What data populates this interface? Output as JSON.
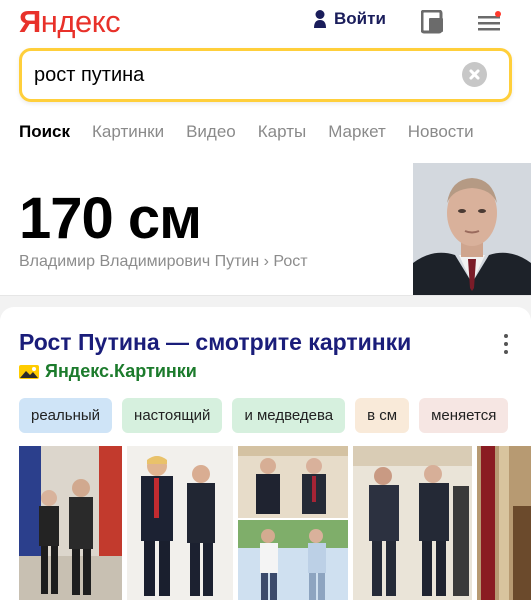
{
  "header": {
    "logo_first": "Я",
    "logo_rest": "ндекс",
    "login_label": "Войти",
    "tab_icon": "tabs-icon",
    "menu_icon": "hamburger-menu-icon"
  },
  "search": {
    "query": "рост путина",
    "clear_icon": "clear-icon"
  },
  "tabs": [
    {
      "label": "Поиск",
      "active": true
    },
    {
      "label": "Картинки"
    },
    {
      "label": "Видео"
    },
    {
      "label": "Карты"
    },
    {
      "label": "Маркет"
    },
    {
      "label": "Новости"
    }
  ],
  "fact": {
    "value": "170 см",
    "breadcrumb": "Владимир Владимирович Путин › Рост"
  },
  "images_card": {
    "title": "Рост Путина — смотрите картинки",
    "source": "Яндекс.Картинки",
    "chips": [
      {
        "label": "реальный",
        "color": "#cfe4f7"
      },
      {
        "label": "настоящий",
        "color": "#d6f0de"
      },
      {
        "label": "и медведева",
        "color": "#d6f0de"
      },
      {
        "label": "в см",
        "color": "#f9ead9"
      },
      {
        "label": "меняется",
        "color": "#f6e6e3"
      }
    ]
  },
  "colors": {
    "logo_red": "#e8312a",
    "search_border": "#ffcf3b",
    "title_blue": "#1a1d7a",
    "source_green": "#1c7b2c"
  }
}
